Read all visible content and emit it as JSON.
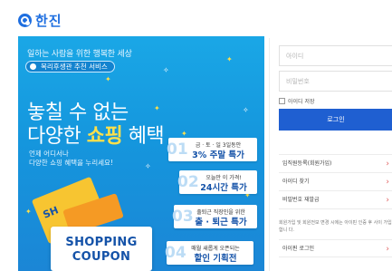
{
  "header": {
    "logo_text": "한진"
  },
  "banner": {
    "tagline": "일하는 사람을 위한 행복한 세상",
    "pill_label": "복리후생관 추천 서비스",
    "headline_line1": "놓칠 수 없는",
    "headline_line2_prefix": "다양한 ",
    "headline_line2_highlight": "쇼핑",
    "headline_line2_suffix": " 혜택",
    "sub_line1": "언제 어디서나",
    "sub_line2": "다양한 쇼핑 혜택을 누리세요!",
    "promos": [
      {
        "num": "01",
        "small": "금 · 토 · 일 3일동안",
        "big": "3% 주말 특가"
      },
      {
        "num": "02",
        "small": "오늘만 이 가격!",
        "big": "24시간 특가"
      },
      {
        "num": "03",
        "small": "출퇴근 직장인을 위한",
        "big": "출 · 퇴근 특가"
      },
      {
        "num": "04",
        "small": "매월 새롭게 오픈되는",
        "big": "할인 기획전"
      }
    ],
    "coupon_line1": "SHOPPING",
    "coupon_line2": "COUPON",
    "colors": {
      "banner_blue": "#1596dd",
      "accent_yellow": "#ffe04a",
      "promo_blue": "#1452a8"
    }
  },
  "login": {
    "id_placeholder": "아이디",
    "pw_placeholder": "비밀번호",
    "save_id_label": "아이디 저장",
    "login_button": "로그인",
    "links": [
      {
        "label": "임직원등록(회원가입)",
        "icon": "chevron-right-icon"
      },
      {
        "label": "아이디 찾기",
        "icon": "chevron-right-icon"
      },
      {
        "label": "비밀번호 재발급",
        "icon": "chevron-right-icon"
      }
    ],
    "notice": "회원가입 및 회원전보 변경 시에는 아이핀 인증 후 사이 가입합니 다.",
    "bottom_link": "아이핀 로그인",
    "colors": {
      "button_blue": "#1f5fd1",
      "arrow_red": "#e05a5a"
    }
  }
}
